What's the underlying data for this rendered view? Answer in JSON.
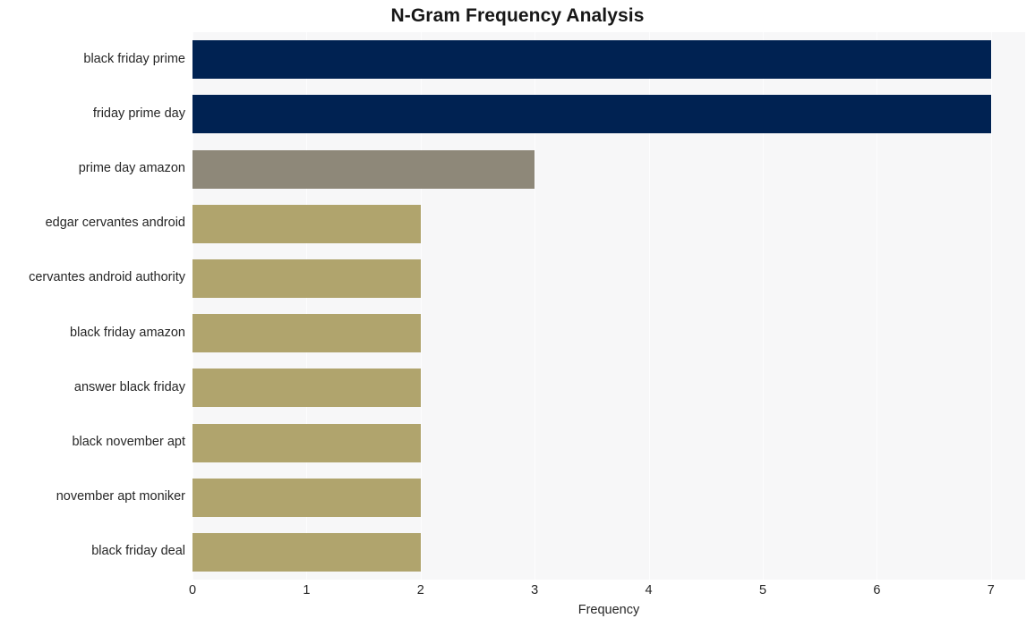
{
  "chart_data": {
    "type": "bar",
    "orientation": "horizontal",
    "title": "N-Gram Frequency Analysis",
    "xlabel": "Frequency",
    "ylabel": "",
    "xlim": [
      0,
      7.3
    ],
    "ylim": [
      0,
      10
    ],
    "grid": true,
    "legend": null,
    "x_ticks": [
      "0",
      "1",
      "2",
      "3",
      "4",
      "5",
      "6",
      "7"
    ],
    "x_tick_values": [
      0,
      1,
      2,
      3,
      4,
      5,
      6,
      7
    ],
    "categories": [
      "black friday prime",
      "friday prime day",
      "prime day amazon",
      "edgar cervantes android",
      "cervantes android authority",
      "black friday amazon",
      "answer black friday",
      "black november apt",
      "november apt moniker",
      "black friday deal"
    ],
    "values": [
      7,
      7,
      3,
      2,
      2,
      2,
      2,
      2,
      2,
      2
    ],
    "bar_colors": [
      "#002252",
      "#002252",
      "#8e8879",
      "#b0a46d",
      "#b0a46d",
      "#b0a46d",
      "#b0a46d",
      "#b0a46d",
      "#b0a46d",
      "#b0a46d"
    ]
  },
  "style": {
    "plot_background": "#f7f7f8",
    "page_background": "#ffffff",
    "gridline_color": "#fdfdfe",
    "text_color": "#262626",
    "title_color": "#171717"
  }
}
